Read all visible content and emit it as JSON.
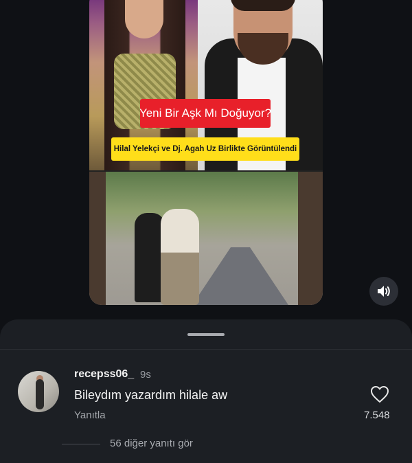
{
  "video": {
    "headline": "Yeni Bir Aşk Mı Doğuyor?",
    "subheadline": "Hilal Yelekçi ve Dj. Agah Uz Birlikte Görüntülendi"
  },
  "controls": {
    "sound_icon": "speaker-on-icon"
  },
  "comment": {
    "username": "recepss06_",
    "time": "9s",
    "text": "Bileydım yazardım hilale aw",
    "reply_label": "Yanıtla",
    "like_count": "7.548",
    "like_icon": "heart-outline-icon"
  },
  "replies": {
    "more_label": "56 diğer yanıtı gör"
  },
  "colors": {
    "background": "#0f1115",
    "sheet": "#1c1f24",
    "headline_bg": "#e8202a",
    "subheadline_bg": "#ffde1a"
  }
}
